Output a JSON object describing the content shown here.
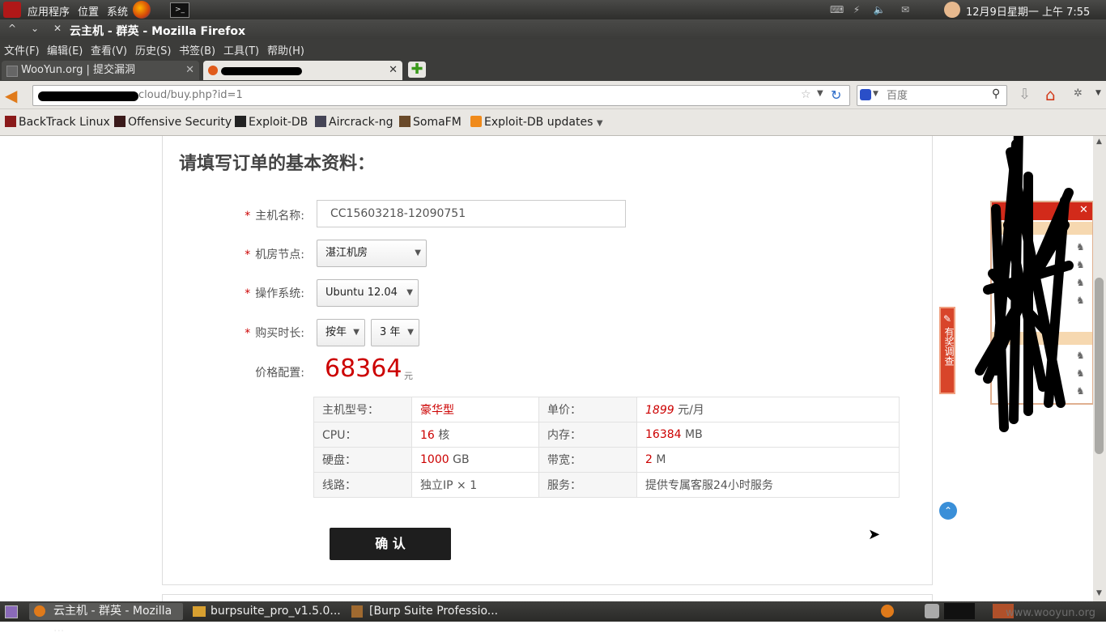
{
  "top_panel": {
    "menus": [
      "应用程序",
      "位置",
      "系统"
    ],
    "clock": "12月9日星期一 上午  7:55"
  },
  "window": {
    "title": "云主机 - 群英 - Mozilla Firefox"
  },
  "menubar": [
    "文件(F)",
    "编辑(E)",
    "查看(V)",
    "历史(S)",
    "书签(B)",
    "工具(T)",
    "帮助(H)"
  ],
  "tabs": [
    {
      "label": "WooYun.org | 提交漏洞",
      "active": false
    },
    {
      "label": "",
      "active": true
    }
  ],
  "address_bar": {
    "url": "cloud/buy.php?id=1"
  },
  "search_bar": {
    "placeholder": "百度"
  },
  "bookmarks": [
    "BackTrack Linux",
    "Offensive Security",
    "Exploit-DB",
    "Aircrack-ng",
    "SomaFM",
    "Exploit-DB updates"
  ],
  "page": {
    "heading": "请填写订单的基本资料：",
    "form": {
      "hostname_label": "主机名称:",
      "hostname_value": "CC15603218-12090751",
      "datacenter_label": "机房节点:",
      "datacenter_value": "湛江机房",
      "os_label": "操作系统:",
      "os_value": "Ubuntu 12.04",
      "duration_label": "购买时长:",
      "duration_unit": "按年",
      "duration_value": "3 年",
      "price_label": "价格配置:",
      "price_value": "68364",
      "price_unit": "元"
    },
    "spec": {
      "model_label": "主机型号：",
      "model_value": "豪华型",
      "unit_price_label": "单价：",
      "unit_price_value": "1899",
      "unit_price_unit": "元/月",
      "cpu_label": "CPU：",
      "cpu_value": "16",
      "cpu_unit": "核",
      "mem_label": "内存：",
      "mem_value": "16384",
      "mem_unit": "MB",
      "disk_label": "硬盘：",
      "disk_value": "1000",
      "disk_unit": "GB",
      "bw_label": "带宽：",
      "bw_value": "2",
      "bw_unit": "M",
      "line_label": "线路：",
      "line_value": "独立IP × 1",
      "service_label": "服务：",
      "service_value": "提供专属客服24小时服务"
    },
    "confirm_button": "确 认",
    "survey_tab": "有奖调查"
  },
  "taskbar": {
    "items": [
      "云主机 - 群英 - Mozilla ...",
      "burpsuite_pro_v1.5.0...",
      "[Burp Suite Professio..."
    ],
    "watermark": "www.wooyun.org"
  },
  "colors": {
    "accent_red": "#cc0000",
    "panel_dark": "#3c3c3a"
  }
}
